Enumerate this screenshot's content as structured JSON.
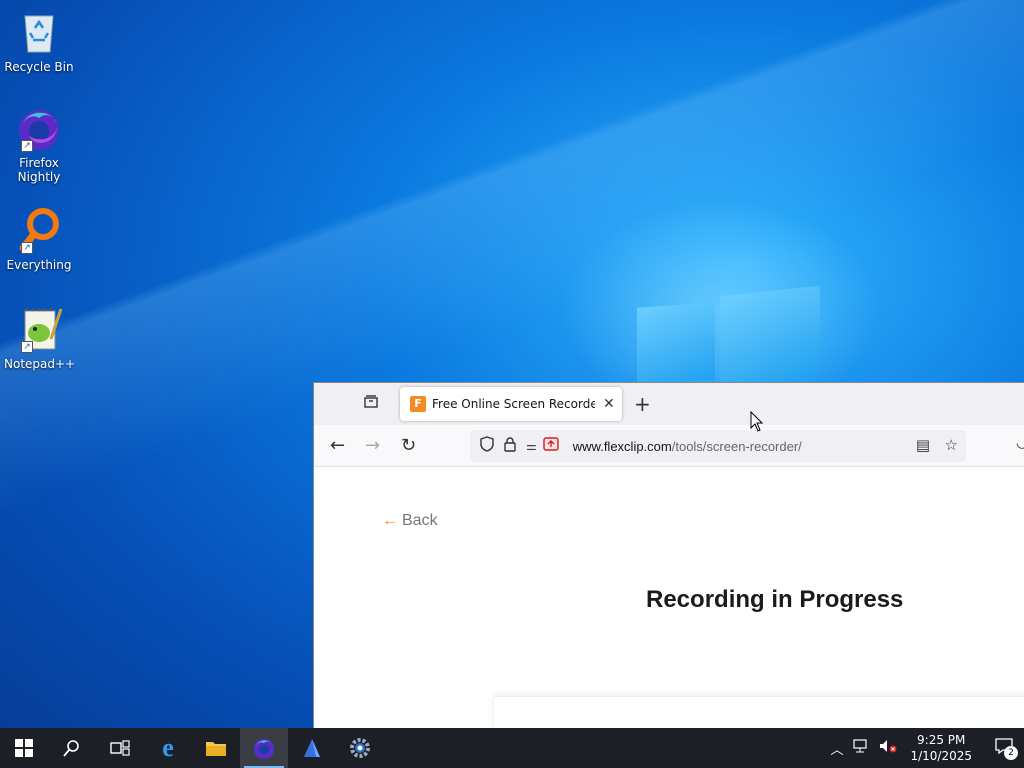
{
  "desktop": {
    "icons": [
      {
        "label": "Recycle Bin"
      },
      {
        "label": "Firefox Nightly"
      },
      {
        "label": "Everything"
      },
      {
        "label": "Notepad++"
      }
    ]
  },
  "browser": {
    "tab": {
      "favicon": "F",
      "title": "Free Online Screen Recorder &"
    },
    "url": {
      "host": "www.flexclip.com",
      "path": "/tools/screen-recorder/"
    },
    "page": {
      "back_label": "Back",
      "heading": "Recording in Progress"
    }
  },
  "taskbar": {
    "clock_time": "9:25 PM",
    "clock_date": "1/10/2025",
    "notification_count": "2"
  },
  "colors": {
    "accent_orange": "#f5892a",
    "taskbar_bg": "#1d1f26",
    "active_underline": "#76b9ed"
  }
}
